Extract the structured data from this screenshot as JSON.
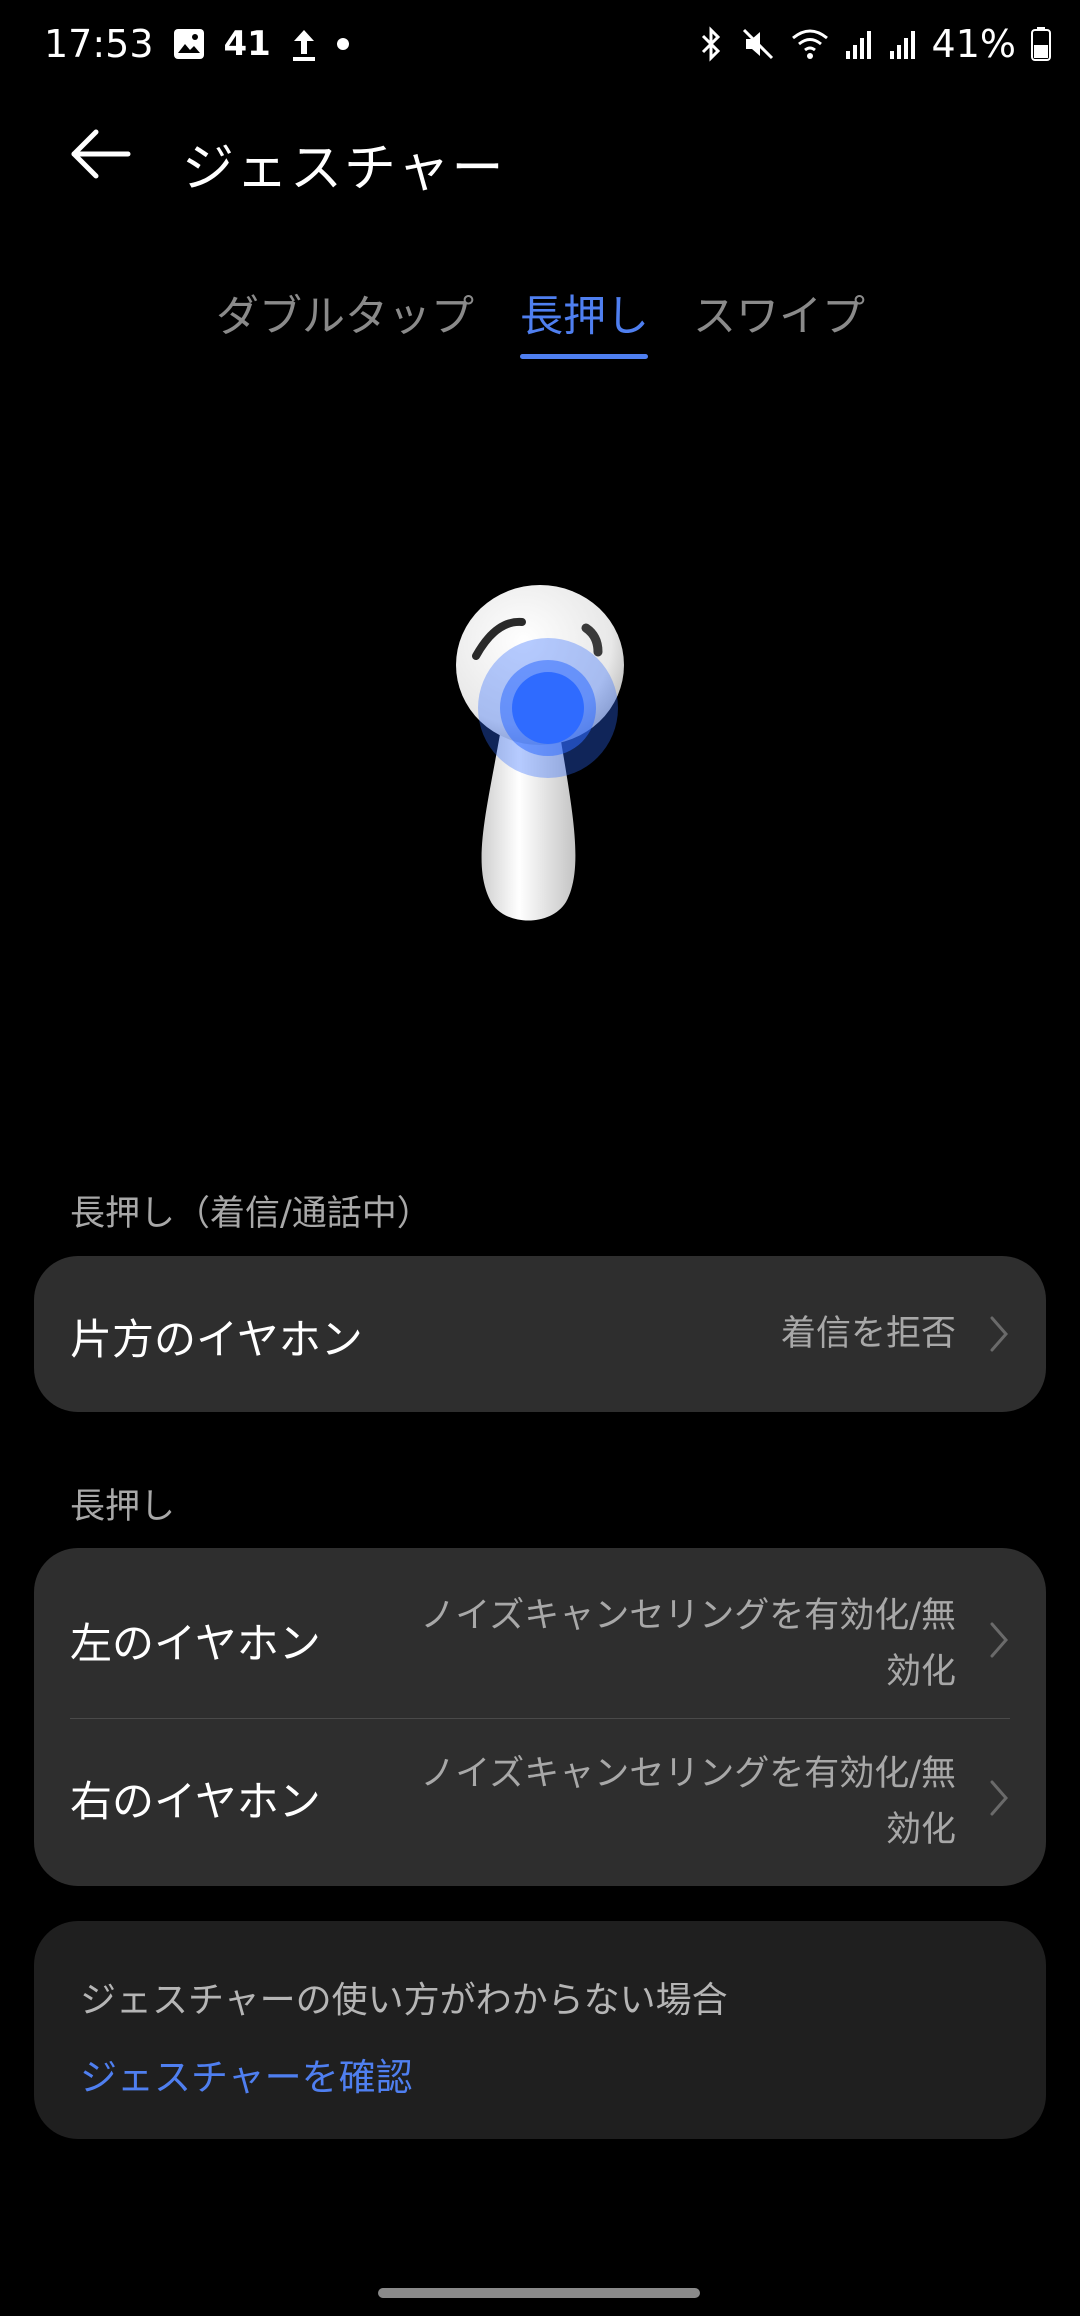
{
  "status_bar": {
    "time": "17:53",
    "notification_count": "41",
    "battery": "41%"
  },
  "header": {
    "title": "ジェスチャー"
  },
  "tabs": [
    {
      "label": "ダブルタップ",
      "active": false
    },
    {
      "label": "長押し",
      "active": true
    },
    {
      "label": "スワイプ",
      "active": false
    }
  ],
  "section_call": {
    "label": "長押し（着信/通話中）",
    "row": {
      "title": "片方のイヤホン",
      "value": "着信を拒否"
    }
  },
  "section_hold": {
    "label": "長押し",
    "rows": [
      {
        "title": "左のイヤホン",
        "value_line1": "ノイズキャンセリングを有効化/無",
        "value_line2": "効化"
      },
      {
        "title": "右のイヤホン",
        "value_line1": "ノイズキャンセリングを有効化/無",
        "value_line2": "効化"
      }
    ]
  },
  "help": {
    "text": "ジェスチャーの使い方がわからない場合",
    "link": "ジェスチャーを確認"
  },
  "colors": {
    "accent": "#4f7ff0",
    "card": "#2e2e2e",
    "background": "#000000"
  }
}
